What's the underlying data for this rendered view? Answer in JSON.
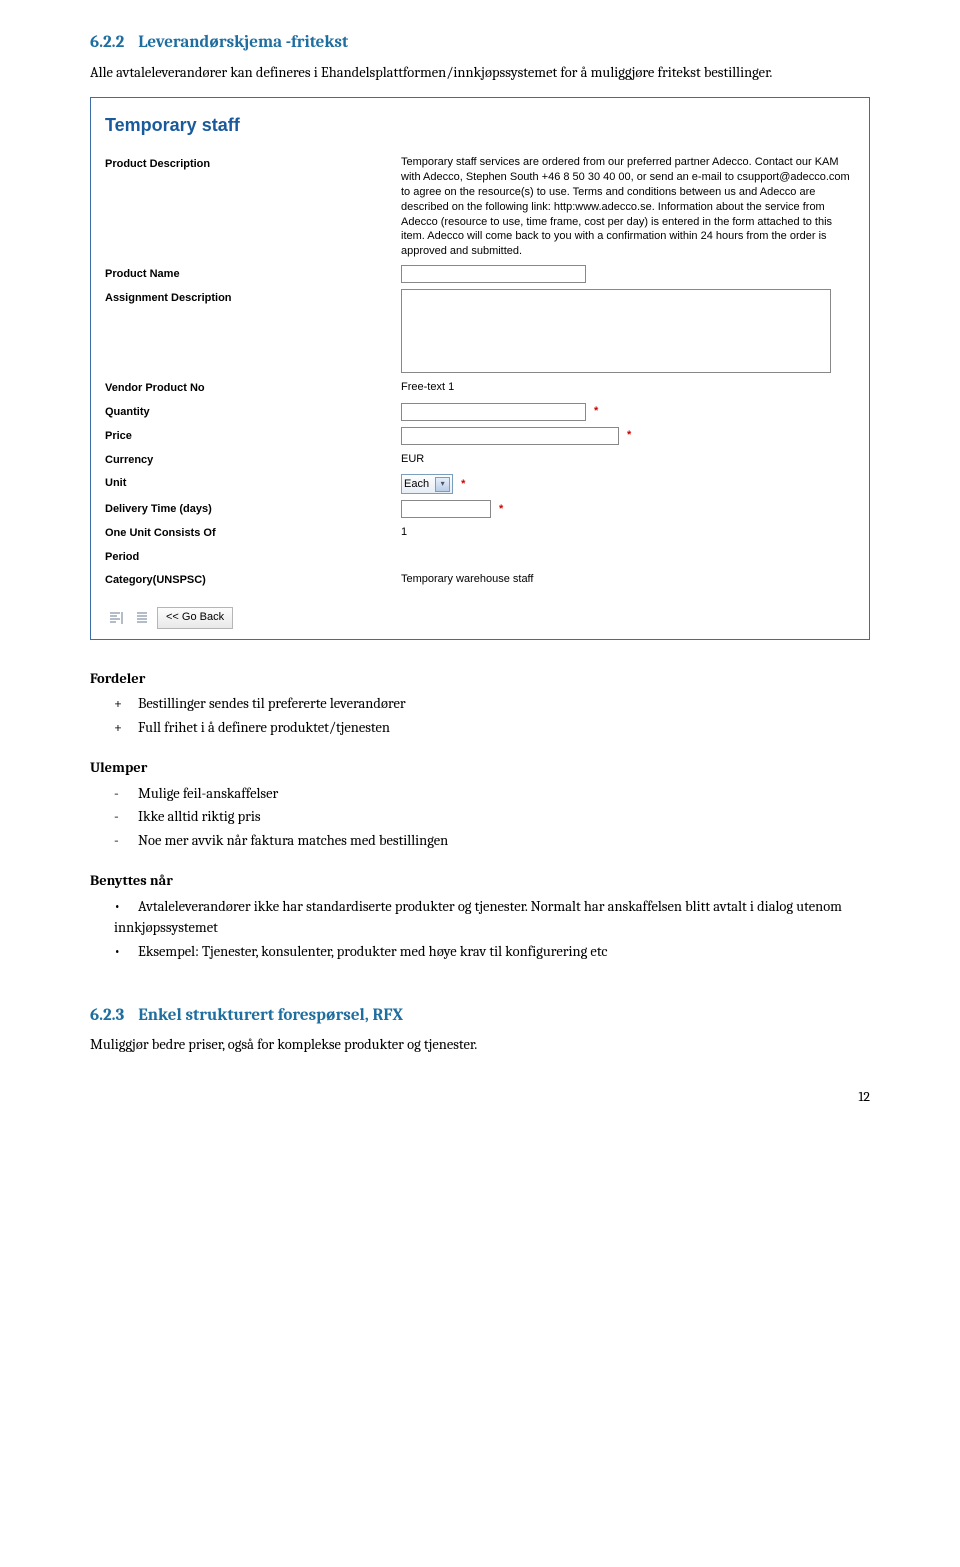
{
  "s1": {
    "num": "6.2.2",
    "title": "Leverandørskjema -fritekst",
    "body": "Alle avtaleleverandører kan defineres i Ehandelsplattformen/innkjøpssystemet for å muliggjøre fritekst bestillinger."
  },
  "form": {
    "title": "Temporary staff",
    "rows": {
      "pd_label": "Product Description",
      "pd_value": "Temporary staff services are ordered from our preferred partner Adecco. Contact our KAM with Adecco, Stephen South +46 8 50 30 40 00, or send an e-mail to csupport@adecco.com to agree on the resource(s) to use. Terms and conditions between us and Adecco are described on the following link: http:www.adecco.se. Information about the service from Adecco (resource to use, time frame, cost per day) is entered in the form attached to this item. Adecco will come back to you with a confirmation within 24 hours from the order is approved and submitted.",
      "pn_label": "Product Name",
      "ad_label": "Assignment Description",
      "vpn_label": "Vendor Product No",
      "vpn_value": "Free-text 1",
      "qty_label": "Quantity",
      "price_label": "Price",
      "cur_label": "Currency",
      "cur_value": "EUR",
      "unit_label": "Unit",
      "unit_value": "Each",
      "dt_label": "Delivery Time (days)",
      "ouc_label": "One Unit Consists Of",
      "ouc_value": "1",
      "per_label": "Period",
      "cat_label": "Category(UNSPSC)",
      "cat_value": "Temporary warehouse staff"
    },
    "go_back": "<< Go Back"
  },
  "fordeler": {
    "heading": "Fordeler",
    "items": [
      "Bestillinger sendes til prefererte leverandører",
      "Full frihet i å definere produktet/tjenesten"
    ]
  },
  "ulemper": {
    "heading": "Ulemper",
    "items": [
      "Mulige feil-anskaffelser",
      "Ikke alltid riktig pris",
      "Noe mer avvik når faktura matches med bestillingen"
    ]
  },
  "benyttes": {
    "heading": "Benyttes når",
    "items": [
      "Avtaleleverandører ikke har standardiserte produkter og tjenester. Normalt har anskaffelsen blitt avtalt i dialog utenom innkjøpssystemet",
      "Eksempel: Tjenester, konsulenter, produkter med høye krav til konfigurering etc"
    ]
  },
  "s2": {
    "num": "6.2.3",
    "title": "Enkel strukturert forespørsel, RFX",
    "body": "Muliggjør bedre priser, også for komplekse produkter og tjenester."
  },
  "page_number": "12"
}
